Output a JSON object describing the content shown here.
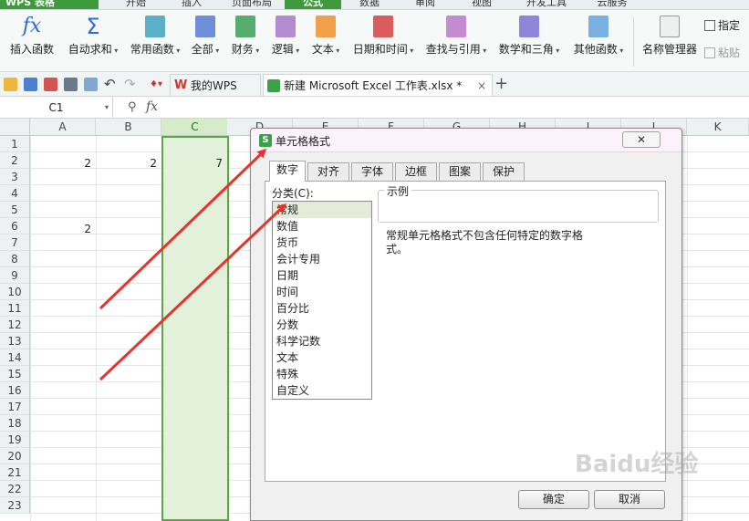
{
  "app": {
    "menu_label": "WPS 表格"
  },
  "ribbon_tabs": [
    "开始",
    "插入",
    "页面布局",
    "公式",
    "数据",
    "审阅",
    "视图",
    "开发工具",
    "云服务"
  ],
  "ribbon_active_tab": "公式",
  "ribbon": {
    "insert_function": "插入函数",
    "autosum": "自动求和",
    "common_functions": "常用函数",
    "all": "全部",
    "financial": "财务",
    "logical": "逻辑",
    "text": "文本",
    "datetime": "日期和时间",
    "lookup": "查找与引用",
    "math": "数学和三角",
    "other": "其他函数",
    "name_manager": "名称管理器",
    "specify": "指定",
    "paste": "粘贴"
  },
  "document_tabs": [
    {
      "label": "我的WPS",
      "active": false
    },
    {
      "label": "新建 Microsoft Excel 工作表.xlsx *",
      "active": true
    }
  ],
  "new_tab_symbol": "+",
  "close_symbol": "×",
  "formula_bar": {
    "name_box": "C1",
    "fx": "fx",
    "value": ""
  },
  "columns": [
    "A",
    "B",
    "C",
    "D",
    "E",
    "F",
    "G",
    "H",
    "I",
    "J",
    "K"
  ],
  "selected_column": "C",
  "rows": [
    "1",
    "2",
    "3",
    "4",
    "5",
    "6",
    "7",
    "8",
    "9",
    "10",
    "11",
    "12",
    "13",
    "14",
    "15",
    "16",
    "17",
    "18",
    "19",
    "20",
    "21",
    "22",
    "23"
  ],
  "cells": {
    "A2": "2",
    "B2": "2",
    "C2": "7",
    "A6": "2"
  },
  "dialog": {
    "title": "单元格格式",
    "close_label": "✕",
    "tabs": [
      "数字",
      "对齐",
      "字体",
      "边框",
      "图案",
      "保护"
    ],
    "active_tab": "数字",
    "category_label": "分类(C):",
    "categories": [
      "常规",
      "数值",
      "货币",
      "会计专用",
      "日期",
      "时间",
      "百分比",
      "分数",
      "科学记数",
      "文本",
      "特殊",
      "自定义"
    ],
    "selected_category": "常规",
    "sample_label": "示例",
    "description": "常规单元格格式不包含任何特定的数字格式。",
    "ok_label": "确定",
    "cancel_label": "取消"
  },
  "annotation_color": "#e8322c",
  "accent_color": "#3e9a3c",
  "watermark": "Baidu经验"
}
